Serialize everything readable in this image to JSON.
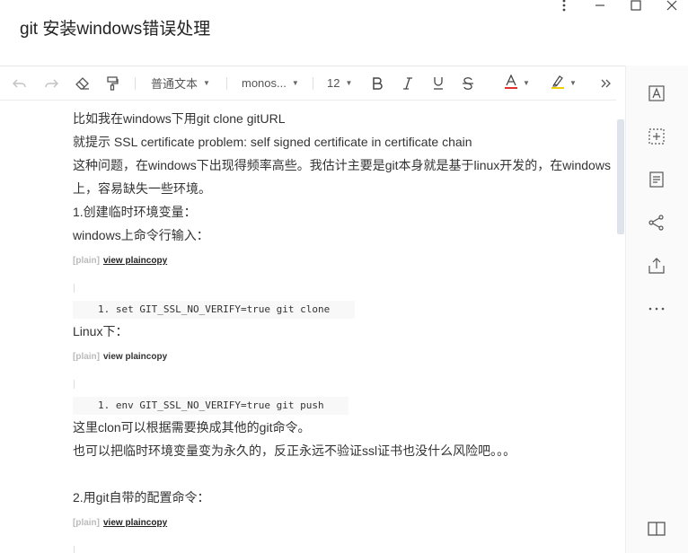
{
  "window": {
    "title": "git 安装windows错误处理",
    "controls": [
      "more-vertical-icon",
      "minimize-icon",
      "maximize-icon",
      "close-icon"
    ]
  },
  "toolbar": {
    "paragraph_style": "普通文本",
    "font_family": "monos...",
    "font_size": "12",
    "icons": [
      "undo-icon",
      "redo-icon",
      "eraser-icon",
      "format-painter-icon",
      "bold-icon",
      "italic-icon",
      "underline-icon",
      "strikethrough-icon",
      "font-color-icon",
      "highlight-icon",
      "more-chevrons-icon"
    ],
    "font_color": "#e0332c",
    "highlight_color": "#f2d000"
  },
  "right_panel": {
    "icons": [
      "text-box-icon",
      "add-block-icon",
      "document-icon",
      "share-icon",
      "export-icon",
      "more-icon",
      "toggle-panel-icon"
    ]
  },
  "content": {
    "lines": [
      "比如我在windows下用git clone gitURL",
      "就提示  SSL certificate problem: self signed certificate in certificate chain",
      "这种问题，在windows下出现得频率高些。我估计主要是git本身就是基于linux开发的，在windows",
      "上，容易缺失一些环境。",
      "1.创建临时环境变量：",
      "windows上命令行输入："
    ],
    "plain_tag": "[plain]",
    "view_plaincopy": "view plaincopy",
    "code1": "1. set GIT_SSL_NO_VERIFY=true git clone",
    "linux_line": "Linux下：",
    "code2": "1. env GIT_SSL_NO_VERIFY=true git push",
    "after_lines": [
      "这里clon可以根据需要换成其他的git命令。",
      "也可以把临时环境变量变为永久的，反正永远不验证ssl证书也没什么风险吧。。。"
    ],
    "section2": "2.用git自带的配置命令："
  }
}
